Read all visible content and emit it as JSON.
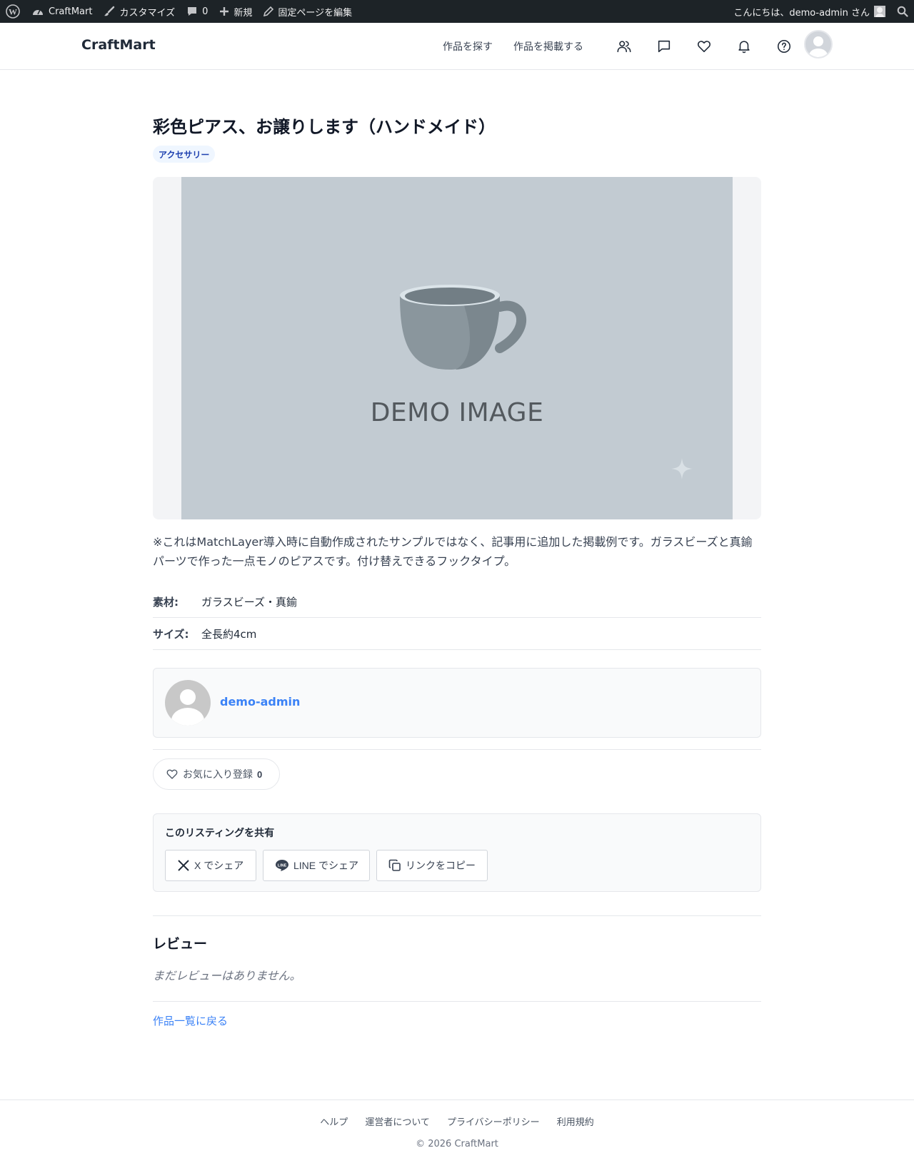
{
  "adminbar": {
    "site_name": "CraftMart",
    "customize": "カスタマイズ",
    "comments_count": "0",
    "new": "新規",
    "edit_page": "固定ページを編集",
    "greeting": "こんにちは、demo-admin さん"
  },
  "header": {
    "brand": "CraftMart",
    "nav": {
      "browse": "作品を探す",
      "post": "作品を掲載する"
    }
  },
  "listing": {
    "title": "彩色ピアス、お譲りします（ハンドメイド）",
    "category": "アクセサリー",
    "image_text": "DEMO IMAGE",
    "description": "※これはMatchLayer導入時に自動作成されたサンプルではなく、記事用に追加した掲載例です。ガラスビーズと真鍮パーツで作った一点モノのピアスです。付け替えできるフックタイプ。",
    "specs": [
      {
        "label": "素材:",
        "value": "ガラスビーズ・真鍮"
      },
      {
        "label": "サイズ:",
        "value": "全長約4cm"
      }
    ],
    "author": "demo-admin",
    "favorite_label": "お気に入り登録",
    "favorite_count": "0"
  },
  "share": {
    "title": "このリスティングを共有",
    "x_label": "X でシェア",
    "line_label": "LINE でシェア",
    "copy_label": "リンクをコピー"
  },
  "reviews": {
    "heading": "レビュー",
    "empty": "まだレビューはありません。"
  },
  "back_link": "作品一覧に戻る",
  "footer": {
    "links": [
      "ヘルプ",
      "運営者について",
      "プライバシーポリシー",
      "利用規約"
    ],
    "copyright": "© 2026 CraftMart"
  },
  "colors": {
    "adminbar_bg": "#1d2327",
    "accent": "#3b82f6",
    "badge_bg": "#eff6ff",
    "badge_text": "#1e40af",
    "image_bg": "#c2cbd2"
  }
}
